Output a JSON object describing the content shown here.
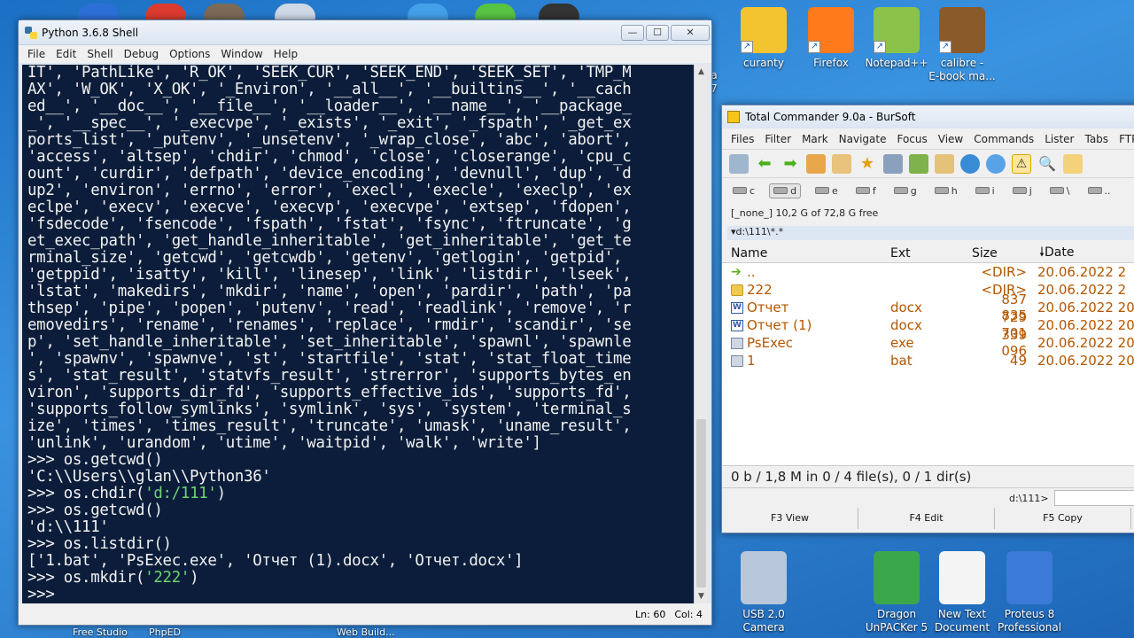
{
  "desktop": {
    "right_icons": [
      {
        "label": "a\n7",
        "color": "#4a7fd4"
      },
      {
        "label": "curanty",
        "color": "#f4c430"
      },
      {
        "label": "Firefox",
        "color": "#ff7a1a"
      },
      {
        "label": "Notepad++",
        "color": "#8bc34a"
      },
      {
        "label": "calibre -\nE-book ma...",
        "color": "#8b5a2b"
      }
    ],
    "bottom_icons": [
      {
        "label": "USB 2.0\nCamera",
        "color": "#b8c7d9"
      },
      {
        "label": "Dragon\nUnPACKer 5",
        "color": "#3aa84a"
      },
      {
        "label": "New Text\nDocument",
        "color": "#f4f4f4"
      },
      {
        "label": "Proteus 8\nProfessional",
        "color": "#3b7ad6"
      }
    ],
    "bottom_labels": [
      "Free Studio",
      "PhpED",
      "Web Build..."
    ]
  },
  "python_shell": {
    "title": "Python 3.6.8 Shell",
    "menu": [
      "File",
      "Edit",
      "Shell",
      "Debug",
      "Options",
      "Window",
      "Help"
    ],
    "lines": [
      "IT', 'PathLike', 'R_OK', 'SEEK_CUR', 'SEEK_END', 'SEEK_SET', 'TMP_M",
      "AX', 'W_OK', 'X_OK', '_Environ', '__all__', '__builtins__', '__cach",
      "ed__', '__doc__', '__file__', '__loader__', '__name__', '__package_",
      "_', '__spec__', '_execvpe', '_exists', '_exit', '_fspath', '_get_ex",
      "ports_list', '_putenv', '_unsetenv', '_wrap_close', 'abc', 'abort',",
      "'access', 'altsep', 'chdir', 'chmod', 'close', 'closerange', 'cpu_c",
      "ount', 'curdir', 'defpath', 'device_encoding', 'devnull', 'dup', 'd",
      "up2', 'environ', 'errno', 'error', 'execl', 'execle', 'execlp', 'ex",
      "eclpe', 'execv', 'execve', 'execvp', 'execvpe', 'extsep', 'fdopen',",
      "'fsdecode', 'fsencode', 'fspath', 'fstat', 'fsync', 'ftruncate', 'g",
      "et_exec_path', 'get_handle_inheritable', 'get_inheritable', 'get_te",
      "rminal_size', 'getcwd', 'getcwdb', 'getenv', 'getlogin', 'getpid',",
      "'getppid', 'isatty', 'kill', 'linesep', 'link', 'listdir', 'lseek',",
      "'lstat', 'makedirs', 'mkdir', 'name', 'open', 'pardir', 'path', 'pa",
      "thsep', 'pipe', 'popen', 'putenv', 'read', 'readlink', 'remove', 'r",
      "emovedirs', 'rename', 'renames', 'replace', 'rmdir', 'scandir', 'se",
      "p', 'set_handle_inheritable', 'set_inheritable', 'spawnl', 'spawnle",
      "', 'spawnv', 'spawnve', 'st', 'startfile', 'stat', 'stat_float_time",
      "s', 'stat_result', 'statvfs_result', 'strerror', 'supports_bytes_en",
      "viron', 'supports_dir_fd', 'supports_effective_ids', 'supports_fd',",
      "'supports_follow_symlinks', 'symlink', 'sys', 'system', 'terminal_s",
      "ize', 'times', 'times_result', 'truncate', 'umask', 'uname_result',",
      "'unlink', 'urandom', 'utime', 'waitpid', 'walk', 'write']"
    ],
    "session": [
      {
        "prompt": ">>> ",
        "code": "os.getcwd()",
        "arg": ""
      },
      {
        "out": "'C:\\\\Users\\\\glan\\\\Python36'"
      },
      {
        "prompt": ">>> ",
        "code": "os.chdir(",
        "arg": "'d:/111'",
        "tail": ")"
      },
      {
        "prompt": ">>> ",
        "code": "os.getcwd()",
        "arg": ""
      },
      {
        "out": "'d:\\\\111'"
      },
      {
        "prompt": ">>> ",
        "code": "os.listdir()",
        "arg": ""
      },
      {
        "out": "['1.bat', 'PsExec.exe', 'Отчет (1).docx', 'Отчет.docx']"
      },
      {
        "prompt": ">>> ",
        "code": "os.mkdir(",
        "arg": "'222'",
        "tail": ")"
      },
      {
        "prompt": ">>> ",
        "code": "",
        "arg": ""
      }
    ],
    "status": {
      "line": "Ln: 60",
      "col": "Col: 4"
    },
    "buttons": {
      "minimize": "—",
      "maximize": "☐",
      "close": "✕"
    }
  },
  "total_commander": {
    "title": "Total Commander 9.0a - BurSoft",
    "menu": [
      "Files",
      "Filter",
      "Mark",
      "Navigate",
      "Focus",
      "View",
      "Commands",
      "Lister",
      "Tabs",
      "FTP"
    ],
    "drives": [
      "c",
      "d",
      "e",
      "f",
      "g",
      "h",
      "i",
      "j",
      "\\",
      ".."
    ],
    "active_drive": "d",
    "free_space": "[_none_]  10,2 G of 72,8 G free",
    "path": "▾d:\\111\\*.*",
    "columns": {
      "name": "Name",
      "ext": "Ext",
      "size": "Size",
      "date": "Date"
    },
    "files": [
      {
        "name": "..",
        "ext": "",
        "size": "<DIR>",
        "date": "20.06.2022 2",
        "icon": "up"
      },
      {
        "name": "222",
        "ext": "",
        "size": "<DIR>",
        "date": "20.06.2022 2",
        "icon": "dir"
      },
      {
        "name": "Отчет",
        "ext": "docx",
        "size": "837 835",
        "date": "20.06.2022 20",
        "icon": "doc"
      },
      {
        "name": "Отчет (1)",
        "ext": "docx",
        "size": "729 701",
        "date": "20.06.2022 20",
        "icon": "doc"
      },
      {
        "name": "PsExec",
        "ext": "exe",
        "size": "339 096",
        "date": "20.06.2022 20",
        "icon": "exe"
      },
      {
        "name": "1",
        "ext": "bat",
        "size": "49",
        "date": "20.06.2022 20",
        "icon": "exe"
      }
    ],
    "status": "0 b / 1,8 M in 0 / 4 file(s), 0 / 1 dir(s)",
    "cmd_path": "d:\\111>",
    "fkeys": [
      "F3 View",
      "F4 Edit",
      "F5 Copy"
    ]
  }
}
